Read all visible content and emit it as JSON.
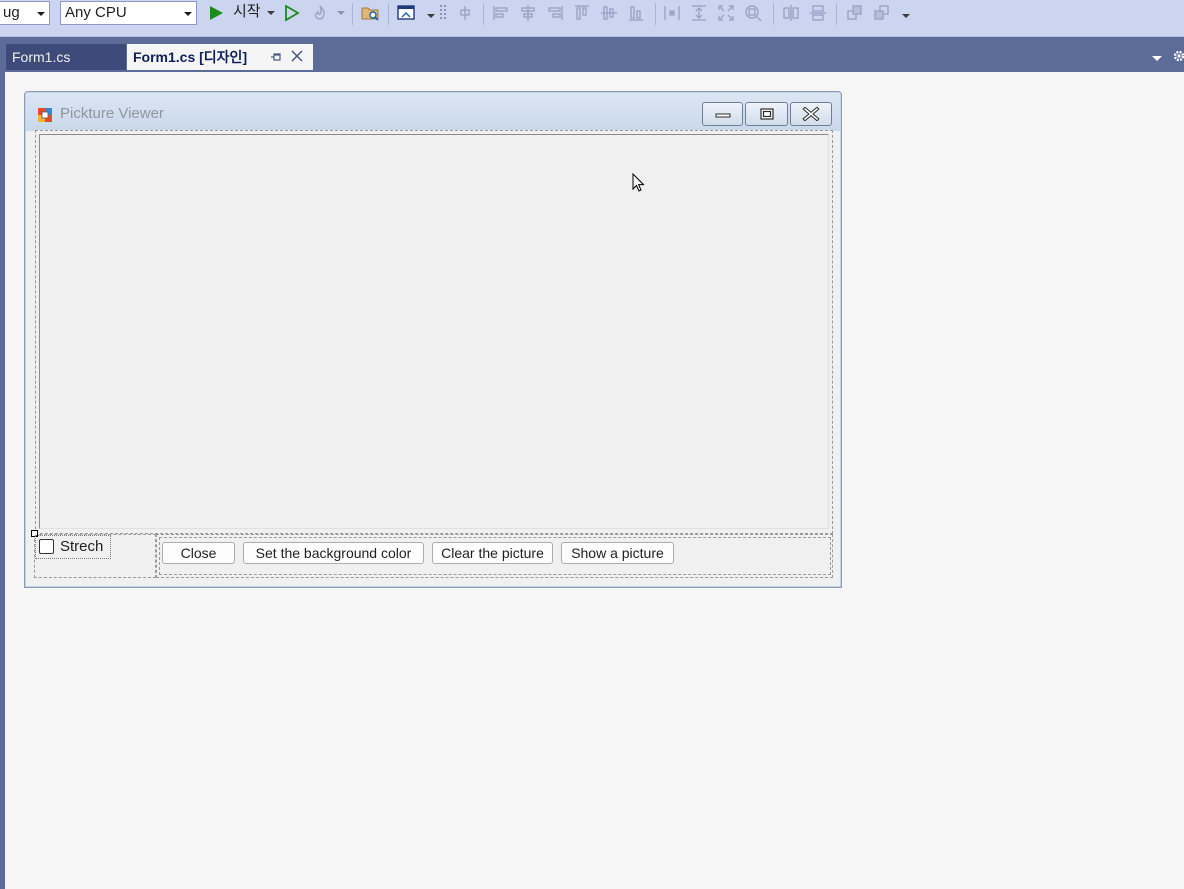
{
  "toolbar": {
    "config_value": "ug",
    "platform_value": "Any CPU",
    "start_label": "시작"
  },
  "tabs": [
    {
      "label": "Form1.cs",
      "active": false
    },
    {
      "label": "Form1.cs [디자인]",
      "active": true
    }
  ],
  "form": {
    "title": "Pickture Viewer",
    "checkbox_label": "Strech",
    "checkbox_checked": false,
    "buttons": {
      "close": "Close",
      "background": "Set the background color",
      "clear": "Clear the picture",
      "show": "Show a picture"
    }
  },
  "colors": {
    "toolbar_bg": "#ccd5f0",
    "tabstrip_bg": "#5d6b99",
    "start_green": "#1e8a1e"
  }
}
